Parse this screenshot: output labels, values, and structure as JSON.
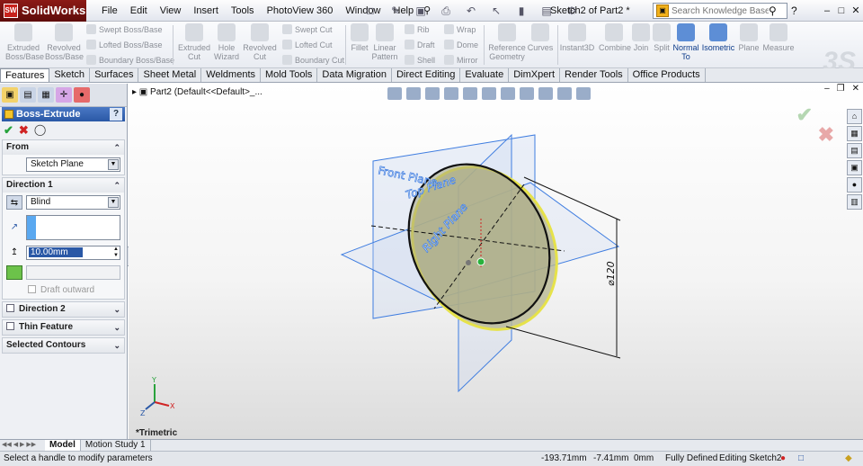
{
  "app": {
    "logo": "SolidWorks",
    "logo_mark": "SW",
    "doc_title": "Sketch2 of Part2 *"
  },
  "menu": [
    "File",
    "Edit",
    "View",
    "Insert",
    "Tools",
    "PhotoView 360",
    "Window",
    "Help"
  ],
  "search": {
    "placeholder": "Search Knowledge Base"
  },
  "command_manager": {
    "extruded_boss": [
      "Extruded",
      "Boss/Base"
    ],
    "revolved_boss": [
      "Revolved",
      "Boss/Base"
    ],
    "swept_boss": "Swept Boss/Base",
    "lofted_boss": "Lofted Boss/Base",
    "boundary_boss": "Boundary Boss/Base",
    "extruded_cut": [
      "Extruded",
      "Cut"
    ],
    "hole_wizard": [
      "Hole",
      "Wizard"
    ],
    "revolved_cut": [
      "Revolved",
      "Cut"
    ],
    "swept_cut": "Swept Cut",
    "lofted_cut": "Lofted Cut",
    "boundary_cut": "Boundary Cut",
    "fillet": "Fillet",
    "linear_pattern": [
      "Linear",
      "Pattern"
    ],
    "rib": "Rib",
    "draft": "Draft",
    "shell": "Shell",
    "wrap": "Wrap",
    "dome": "Dome",
    "mirror": "Mirror",
    "reference_geometry": [
      "Reference",
      "Geometry"
    ],
    "curves": "Curves",
    "instant3d": "Instant3D",
    "combine": "Combine",
    "join": "Join",
    "split": "Split",
    "normal_to": [
      "Normal",
      "To"
    ],
    "isometric": "Isometric",
    "plane": "Plane",
    "measure": "Measure"
  },
  "tabs": [
    "Features",
    "Sketch",
    "Surfaces",
    "Sheet Metal",
    "Weldments",
    "Mold Tools",
    "Data Migration",
    "Direct Editing",
    "Evaluate",
    "DimXpert",
    "Render Tools",
    "Office Products"
  ],
  "property_manager": {
    "title": "Boss-Extrude",
    "help": "?",
    "from": {
      "label": "From",
      "value": "Sketch Plane"
    },
    "direction1": {
      "label": "Direction 1",
      "end_condition": "Blind",
      "depth": "10.00mm",
      "draft_outward": "Draft outward"
    },
    "direction2": {
      "label": "Direction 2"
    },
    "thin_feature": {
      "label": "Thin Feature"
    },
    "selected_contours": {
      "label": "Selected Contours"
    }
  },
  "viewport": {
    "tree_label": "Part2  (Default<<Default>_...",
    "front_plane": "Front Plane",
    "top_plane": "Top Plane",
    "right_plane": "Right Plane",
    "dimension": "⌀120",
    "view_name": "*Trimetric",
    "axis_x": "X",
    "axis_y": "Y",
    "axis_z": "Z"
  },
  "bottom_tabs": [
    "Model",
    "Motion Study 1"
  ],
  "status": {
    "message": "Select a handle to modify parameters",
    "x": "-193.71mm",
    "y": "-7.41mm",
    "z": "0mm",
    "defined": "Fully Defined",
    "editing": "Editing Sketch2"
  },
  "colors": {
    "plane_blue": "#3f7de0",
    "disk_fill": "#b8b892",
    "accent": "#2a58a6"
  }
}
